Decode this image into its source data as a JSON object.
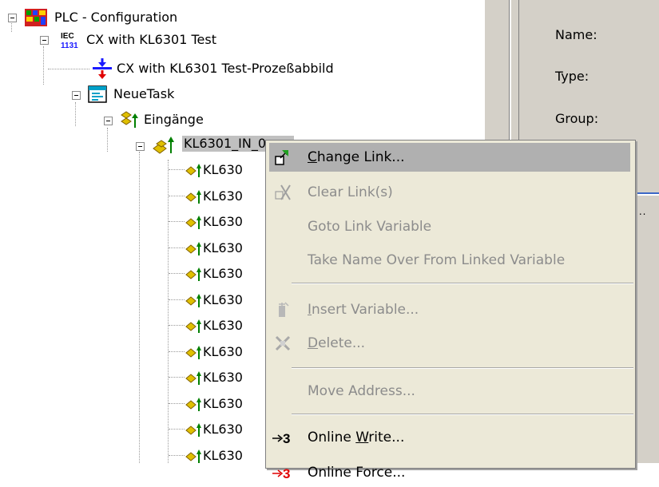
{
  "tree": {
    "root": {
      "label": "PLC - Configuration"
    },
    "project": {
      "label": "CX with KL6301 Test"
    },
    "image": {
      "label": "CX with KL6301 Test-Prozeßabbild"
    },
    "task": {
      "label": "NeueTask"
    },
    "inputs": {
      "label": "Eingänge"
    },
    "selected": {
      "label": "KL6301_IN_0"
    },
    "children": [
      {
        "label": "KL630"
      },
      {
        "label": "KL630"
      },
      {
        "label": "KL630"
      },
      {
        "label": "KL630"
      },
      {
        "label": "KL630"
      },
      {
        "label": "KL630"
      },
      {
        "label": "KL630"
      },
      {
        "label": "KL630"
      },
      {
        "label": "KL630"
      },
      {
        "label": "KL630"
      },
      {
        "label": "KL630"
      },
      {
        "label": "KL630"
      },
      {
        "label": "KL630"
      }
    ]
  },
  "properties": {
    "name_label": "Name:",
    "type_label": "Type:",
    "group_label": "Group:",
    "button_dots": "..."
  },
  "context_menu": {
    "items": [
      {
        "label": "Change Link...",
        "mnemonic": "C",
        "rest": "hange Link...",
        "enabled": true,
        "highlighted": true,
        "icon": "change-link-icon"
      },
      {
        "label": "Clear Link(s)",
        "mnemonic": "",
        "rest": "Clear Link(s)",
        "enabled": false,
        "icon": "clear-link-icon"
      },
      {
        "label": "Goto Link Variable",
        "mnemonic": "",
        "rest": "Goto Link Variable",
        "enabled": false,
        "icon": ""
      },
      {
        "label": "Take Name Over From Linked Variable",
        "mnemonic": "",
        "rest": "Take Name Over From Linked Variable",
        "enabled": false,
        "icon": ""
      },
      {
        "label": "Insert Variable...",
        "mnemonic": "I",
        "rest": "nsert Variable...",
        "enabled": false,
        "icon": "insert-variable-icon"
      },
      {
        "label": "Delete...",
        "mnemonic": "D",
        "rest": "elete...",
        "enabled": false,
        "icon": "delete-icon"
      },
      {
        "label": "Move Address...",
        "mnemonic": "",
        "rest": "Move Address...",
        "enabled": false,
        "icon": ""
      },
      {
        "label": "Online Write...",
        "prefix": "Online ",
        "mnemonic": "W",
        "rest": "rite...",
        "enabled": true,
        "icon": "online-write-icon"
      },
      {
        "label": "Online Force...",
        "enabled": true,
        "icon": "online-force-icon"
      }
    ]
  },
  "colors": {
    "selection_gray": "#c0c0c0",
    "menu_background": "#ece9d8",
    "menu_highlight": "#b0b0b0",
    "disabled_text": "#8c8c8c",
    "panel_gray": "#d4d0c8",
    "icon_yellow": "#e0c000",
    "icon_blue": "#1a1aff",
    "icon_red": "#e00000"
  }
}
